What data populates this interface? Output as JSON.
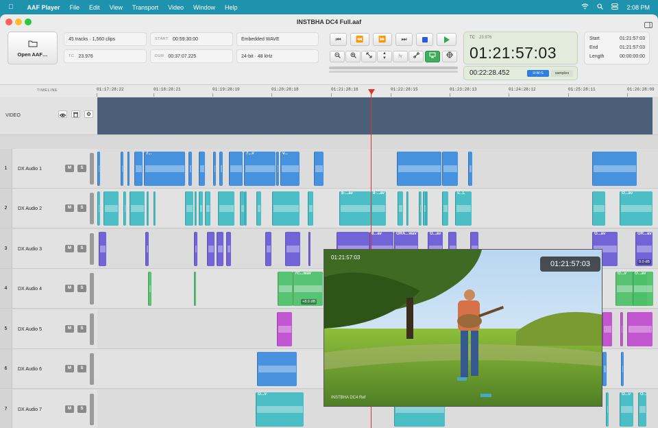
{
  "menubar": {
    "apple": "",
    "app_name": "AAF Player",
    "items": [
      "File",
      "Edit",
      "View",
      "Transport",
      "Video",
      "Window",
      "Help"
    ],
    "time": "2:08 PM"
  },
  "window": {
    "title": "INSTBHA DC4 Full.aaf"
  },
  "toolbar": {
    "open_label": "Open AAF…",
    "tracks_clips": "45 tracks · 1,560 clips",
    "tc_label": "TC",
    "tc_value": "23.976",
    "start_label": "START",
    "start_value": "00:59:30:00",
    "dur_label": "DUR",
    "dur_value": "00:37:07.225",
    "media": "Embedded WAVE",
    "format": "24-bit · 48 kHz"
  },
  "timecode": {
    "fps_label": "TC",
    "fps_value": "23.976",
    "main": "01:21:57:03",
    "secondary": "00:22:28.452",
    "mode_hms": "H:M:S",
    "mode_samples": "samples"
  },
  "selection": {
    "start_label": "Start",
    "start_value": "01:21:57:03",
    "end_label": "End",
    "end_value": "01:21:57:03",
    "length_label": "Length",
    "length_value": "00:00:00:00"
  },
  "ruler": {
    "label": "TIMELINE",
    "ticks": [
      "01:17:28:22",
      "01:18:28:21",
      "01:19:28:19",
      "01:20:28:18",
      "01:21:28:16",
      "01:22:28:15",
      "01:23:28:13",
      "01:24:28:12",
      "01:25:28:11",
      "01:26:28:09"
    ]
  },
  "video_track": {
    "label": "VIDEO"
  },
  "tracks": [
    {
      "num": "1",
      "name": "DX Audio 1",
      "mute": "M",
      "solo": "S"
    },
    {
      "num": "2",
      "name": "DX Audio 2",
      "mute": "M",
      "solo": "S"
    },
    {
      "num": "3",
      "name": "DX Audio 3",
      "mute": "M",
      "solo": "S"
    },
    {
      "num": "4",
      "name": "DX Audio 4",
      "mute": "M",
      "solo": "S"
    },
    {
      "num": "5",
      "name": "DX Audio 5",
      "mute": "M",
      "solo": "S"
    },
    {
      "num": "6",
      "name": "DX Audio 6",
      "mute": "M",
      "solo": "S"
    },
    {
      "num": "7",
      "name": "DX Audio 7",
      "mute": "M",
      "solo": "S"
    }
  ],
  "clip_labels": {
    "t1_a": "7...",
    "t1_b": "7...v",
    "t1_c": "7t",
    "t1_d": "v...",
    "t2_a": "8-...av",
    "t2_b": "8-...av",
    "t2_c": "v...L",
    "t2_d": "O...av",
    "t3_a": "8...av",
    "t3_b": "ORA...wav",
    "t3_c": "O...av",
    "t3_d": "O...av",
    "t3_e": "OR...av",
    "t3_gain": "0.0 dB",
    "t4_a": "7C...wav",
    "t4_gain": "+8.0 dB",
    "t4_b": "O...v",
    "t4_c": "O...av",
    "t7_a": "O...v",
    "t7_b": "O...v",
    "t7_c": "O..."
  },
  "video_window": {
    "tc_small": "01:21:57:03",
    "tc_badge": "01:21:57:03",
    "caption": "INSTBHA DC4 Ref"
  },
  "colors": {
    "blue_clip": "#3b8ce0",
    "teal_clip": "#3fbcc4",
    "purple_clip": "#6a5ad6",
    "green_clip": "#4cc16a",
    "magenta_clip": "#c04ad0",
    "playhead": "#e03030"
  }
}
